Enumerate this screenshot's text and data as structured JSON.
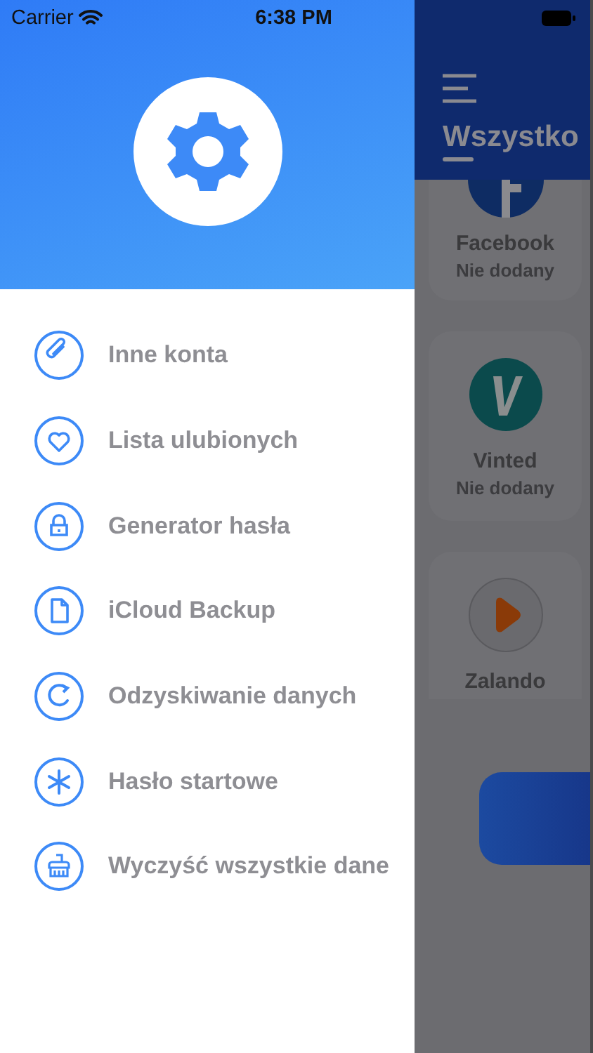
{
  "status_bar": {
    "carrier": "Carrier",
    "time": "6:38 PM"
  },
  "menu": {
    "items": [
      {
        "label": "Inne konta",
        "kind": "paperclip"
      },
      {
        "label": "Lista ulubionych",
        "kind": "heart"
      },
      {
        "label": "Generator hasła",
        "kind": "lock"
      },
      {
        "label": "iCloud Backup",
        "kind": "document"
      },
      {
        "label": "Odzyskiwanie danych",
        "kind": "refresh"
      },
      {
        "label": "Hasło startowe",
        "kind": "asterisk"
      },
      {
        "label": "Wyczyść wszystkie dane",
        "kind": "broom"
      }
    ]
  },
  "background_screen": {
    "tab": "Wszystko",
    "cards": [
      {
        "name": "Facebook",
        "status": "Nie dodany",
        "kind": "facebook"
      },
      {
        "name": "Vinted",
        "status": "Nie dodany",
        "kind": "vinted"
      },
      {
        "name": "Zalando",
        "kind": "zalando"
      }
    ]
  }
}
